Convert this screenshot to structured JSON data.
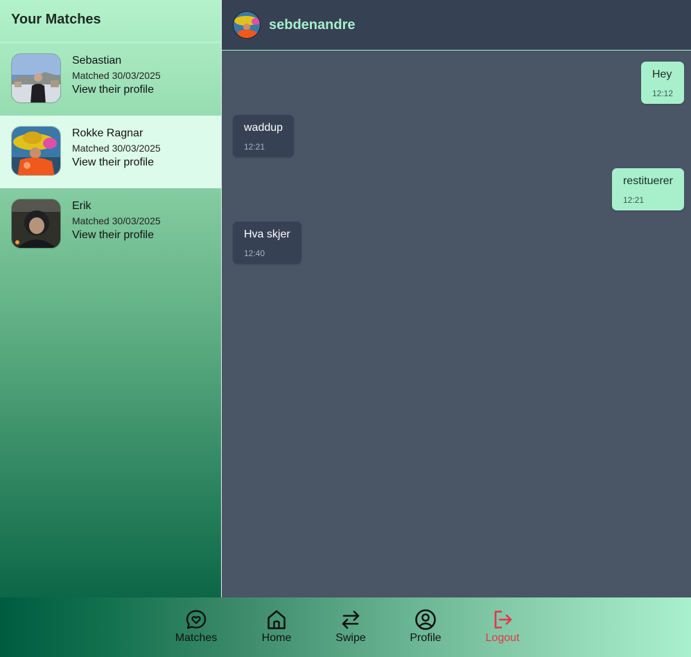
{
  "sidebar": {
    "title": "Your Matches",
    "matches": [
      {
        "name": "Sebastian",
        "matched": "Matched 30/03/2025",
        "link": "View their profile"
      },
      {
        "name": "Rokke Ragnar",
        "matched": "Matched 30/03/2025",
        "link": "View their profile"
      },
      {
        "name": "Erik",
        "matched": "Matched 30/03/2025",
        "link": "View their profile"
      }
    ]
  },
  "chat": {
    "username": "sebdenandre",
    "messages": [
      {
        "direction": "sent",
        "text": "Hey",
        "time": "12:12"
      },
      {
        "direction": "received",
        "text": "waddup",
        "time": "12:21"
      },
      {
        "direction": "sent",
        "text": "restituerer",
        "time": "12:21"
      },
      {
        "direction": "received",
        "text": "Hva skjer",
        "time": "12:40"
      }
    ]
  },
  "nav": {
    "matches": "Matches",
    "home": "Home",
    "swipe": "Swipe",
    "profile": "Profile",
    "logout": "Logout"
  },
  "colors": {
    "accent": "#a7f0cb",
    "chat_bg": "#4a5566",
    "header_bg": "#364154",
    "logout": "#e7344a"
  }
}
